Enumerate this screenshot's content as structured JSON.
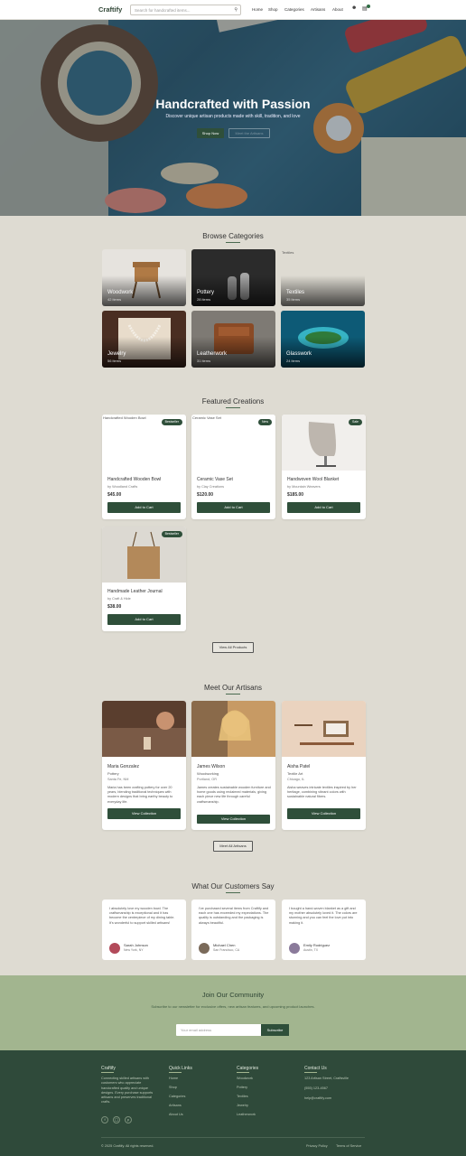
{
  "header": {
    "logo": "Craftify",
    "search_placeholder": "Search for handcrafted items...",
    "nav": [
      "Home",
      "Shop",
      "Categories",
      "Artisans",
      "About"
    ]
  },
  "hero": {
    "title": "Handcrafted with Passion",
    "subtitle": "Discover unique artisan products made with skill, tradition, and love",
    "primary_button": "Shop Now",
    "secondary_button": "Meet the Artisans"
  },
  "categories": {
    "title": "Browse Categories",
    "items": [
      {
        "name": "Woodwork",
        "count": "42 items"
      },
      {
        "name": "Pottery",
        "count": "28 items"
      },
      {
        "name": "Textiles",
        "count": "35 items",
        "alt": "Textiles"
      },
      {
        "name": "Jewelry",
        "count": "56 items"
      },
      {
        "name": "Leatherwork",
        "count": "31 items"
      },
      {
        "name": "Glasswork",
        "count": "24 items"
      }
    ]
  },
  "featured": {
    "title": "Featured Creations",
    "products": [
      {
        "alt": "Handcrafted Wooden Bowl",
        "badge": "Bestseller",
        "name": "Handcrafted Wooden Bowl",
        "maker": "by Woodland Crafts",
        "price": "$45.00",
        "button": "Add to Cart"
      },
      {
        "alt": "Ceramic Vase Set",
        "badge": "New",
        "name": "Ceramic Vase Set",
        "maker": "by Clay Creations",
        "price": "$120.00",
        "button": "Add to Cart"
      },
      {
        "badge": "Sale",
        "name": "Handwoven Wool Blanket",
        "maker": "by Mountain Weavers",
        "price": "$185.00",
        "button": "Add to Cart"
      },
      {
        "badge": "Bestseller",
        "name": "Handmade Leather Journal",
        "maker": "by Craft & Hide",
        "price": "$38.00",
        "button": "Add to Cart"
      }
    ],
    "view_all": "View All Products"
  },
  "artisans": {
    "title": "Meet Our Artisans",
    "items": [
      {
        "name": "Maria Gonzalez",
        "craft": "Pottery",
        "location": "Santa Fe, NM",
        "bio": "Maria has been crafting pottery for over 20 years, blending traditional techniques with modern designs that bring earthy beauty to everyday life.",
        "button": "View Collection"
      },
      {
        "name": "James Wilson",
        "craft": "Woodworking",
        "location": "Portland, OR",
        "bio": "James creates sustainable wooden furniture and home goods using reclaimed materials, giving each piece new life through careful craftsmanship.",
        "button": "View Collection"
      },
      {
        "name": "Aisha Patel",
        "craft": "Textile Art",
        "location": "Chicago, IL",
        "bio": "Aisha weaves intricate textiles inspired by her heritage, combining vibrant colors with sustainable natural fibers.",
        "button": "View Collection"
      }
    ],
    "meet_all": "Meet All Artisans"
  },
  "testimonials": {
    "title": "What Our Customers Say",
    "items": [
      {
        "quote": "I absolutely love my wooden bowl. The craftsmanship is exceptional and it has become the centerpiece of my dining table. It's wonderful to support skilled artisans!",
        "name": "Sarah Johnson",
        "location": "New York, NY"
      },
      {
        "quote": "I've purchased several items from Craftify and each one has exceeded my expectations. The quality is outstanding and the packaging is always beautiful.",
        "name": "Michael Chen",
        "location": "San Francisco, CA"
      },
      {
        "quote": "I bought a hand-woven blanket as a gift and my mother absolutely loved it. The colors are stunning and you can feel the love put into making it.",
        "name": "Emily Rodriguez",
        "location": "Austin, TX"
      }
    ]
  },
  "community": {
    "title": "Join Our Community",
    "text": "Subscribe to our newsletter for exclusive offers, new artisan features, and upcoming product launches.",
    "email_placeholder": "Your email address",
    "button": "Subscribe"
  },
  "footer": {
    "about_title": "Craftify",
    "about_text": "Connecting skilled artisans with customers who appreciate handcrafted quality and unique designs. Every purchase supports artisans and preserves traditional crafts.",
    "quick_title": "Quick Links",
    "quick_links": [
      "Home",
      "Shop",
      "Categories",
      "Artisans",
      "About Us"
    ],
    "cat_title": "Categories",
    "cat_links": [
      "Woodwork",
      "Pottery",
      "Textiles",
      "Jewelry",
      "Leatherwork"
    ],
    "contact_title": "Contact Us",
    "contact": [
      "123 Artisan Street, Craftsville",
      "(555) 123-4567",
      "help@craftify.com"
    ],
    "copyright": "© 2025 Craftify. All rights reserved.",
    "privacy": "Privacy Policy",
    "terms": "Terms of Service"
  }
}
